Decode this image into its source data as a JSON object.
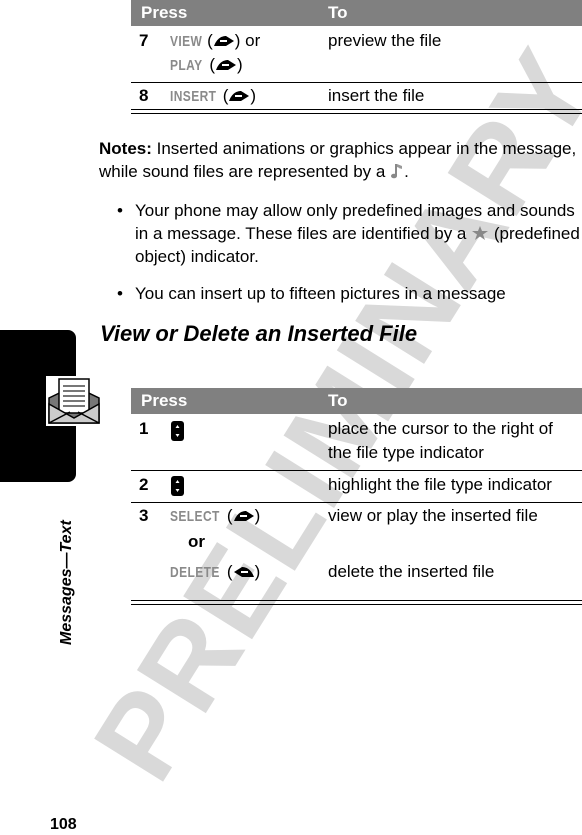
{
  "watermark": "PRELIMINARY",
  "side_tab": {
    "label": "Messages—Text",
    "icon": "envelope-letter-icon"
  },
  "page_number": "108",
  "table_top": {
    "headers": {
      "press": "Press",
      "to": "To"
    },
    "rows": [
      {
        "num": "7",
        "keys": [
          {
            "label": "VIEW",
            "icon": "right-soft-key-icon",
            "suffix": " or"
          },
          {
            "label": "PLAY",
            "icon": "right-soft-key-icon",
            "suffix": ""
          }
        ],
        "to": "preview the file"
      },
      {
        "num": "8",
        "keys": [
          {
            "label": "INSERT",
            "icon": "right-soft-key-icon",
            "suffix": ""
          }
        ],
        "to": "insert the file"
      }
    ]
  },
  "notes": {
    "label": "Notes:",
    "text": " Inserted animations or graphics appear in the message, while sound files are represented by a ",
    "icon": "sound-file-icon",
    "end": "."
  },
  "bullets": [
    {
      "text_before": "Your phone may allow only predefined images and sounds in a message. These files are identified by a ",
      "icon": "star-icon",
      "text_after": " (predefined object) indicator."
    },
    {
      "text": "You can insert up to fifteen pictures in a message"
    }
  ],
  "section_title": "View or Delete an Inserted File",
  "table_bottom": {
    "headers": {
      "press": "Press",
      "to": "To"
    },
    "rows": [
      {
        "num": "1",
        "key_icon": "nav-key-icon",
        "to_line1": "place the cursor to the right of",
        "to_line2": "the file type indicator"
      },
      {
        "num": "2",
        "key_icon": "nav-key-icon",
        "to": "highlight the file type indicator"
      },
      {
        "num": "3",
        "key1": "SELECT",
        "key1_icon": "right-soft-key-icon",
        "to1": "view or play the inserted file",
        "or": "or",
        "key2": "DELETE",
        "key2_icon": "left-soft-key-icon",
        "to2": "delete the inserted file"
      }
    ]
  }
}
